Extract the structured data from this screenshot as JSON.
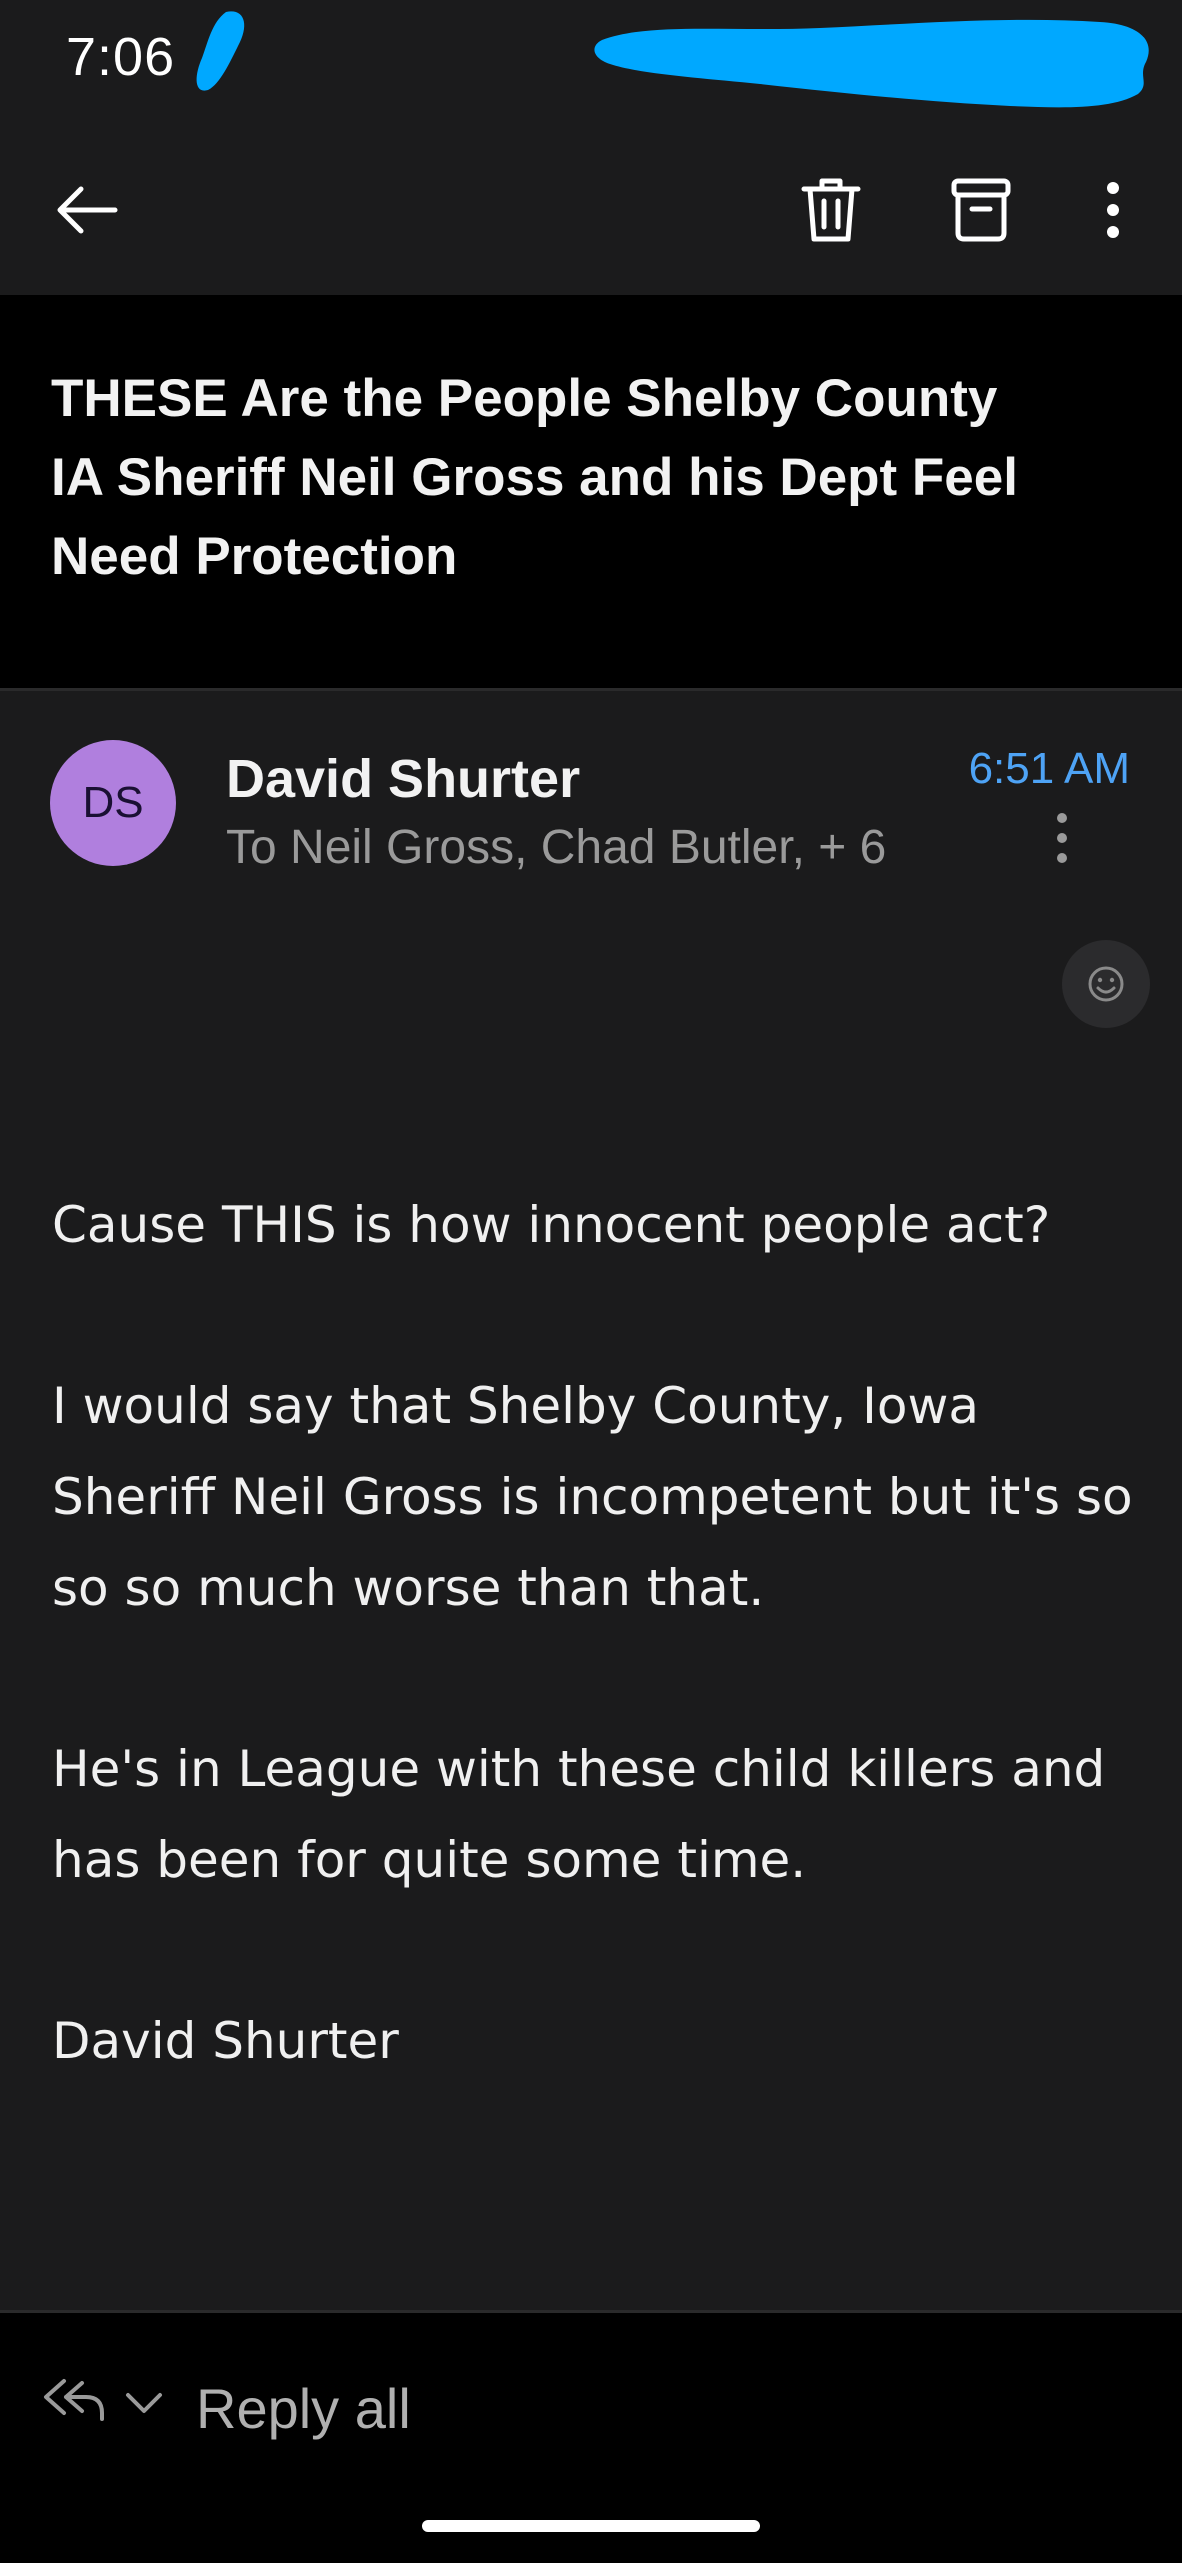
{
  "status_bar": {
    "time": "7:06"
  },
  "toolbar": {
    "back_icon": "arrow-left-icon",
    "delete_icon": "trash-icon",
    "archive_icon": "archive-box-icon",
    "more_icon": "vertical-dots-icon"
  },
  "email": {
    "subject": "THESE Are the People Shelby County IA Sheriff Neil Gross and his Dept Feel Need Protection",
    "sender_initials": "DS",
    "sender_name": "David Shurter",
    "recipients": "To Neil Gross, Chad Butler, + 6",
    "time": "6:51 AM",
    "body": [
      "Cause THIS is how innocent people act?",
      "I would say that Shelby County, Iowa Sheriff Neil Gross is incompetent but it's so so so much worse than that.",
      "He's in League with these child killers and has been for quite some time.",
      "David Shurter"
    ]
  },
  "footer": {
    "reply_all_label": "Reply all"
  },
  "colors": {
    "background": "#1b1b1c",
    "subject_background": "#000000",
    "accent_time": "#4ea3f5",
    "avatar": "#b07fde",
    "redaction": "#00a8ff"
  }
}
